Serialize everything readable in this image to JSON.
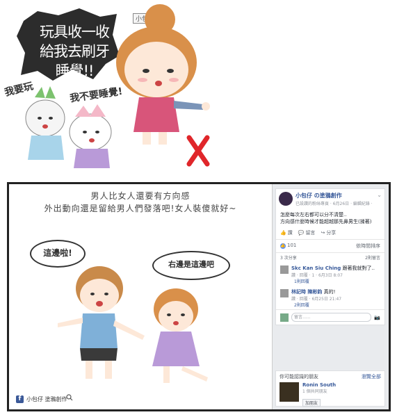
{
  "top_comic": {
    "shout_text": "玩具收一收給我去刷牙睡覺!!",
    "kid1_text": "我要玩",
    "kid2_text": "我不要睡覺!",
    "tag": "小包仔"
  },
  "comic": {
    "caption_line1": "男人比女人還要有方向感",
    "caption_line2": "外出動向還是留給男人們發落吧!女人裝傻就好~",
    "bubble_left": "這邊啦!",
    "bubble_right": "右邊是這邊吧",
    "brand": "小包仔 塗鴉創作"
  },
  "facebook": {
    "page_name": "小包仔 の塗鴉創作",
    "post_meta": "已設讚的粉絲專頁 · 6月26日 · 編輯紀錄 ·",
    "post_text": [
      "怎麼每次左右都可以分不清楚..",
      "方向感什麼時候才能超越那先鼻男生(揉著)"
    ],
    "actions": [
      "讚",
      "留言",
      "分享"
    ],
    "like_count": "101",
    "order_label": "依時間排序",
    "share_label": "3 次分享",
    "shares_right": "2則留言",
    "comments": [
      {
        "name": "Skc Kan Siu Ching",
        "text": "跟著我就對了..",
        "meta": "讚 · 回覆 · 1 · 6月3日 8:07",
        "replies": "1則回覆"
      },
      {
        "name": "林記時 陳彬鈞",
        "text": "真的!",
        "meta": "讚 · 回覆 · 6月25日 21:47",
        "replies": "2則回覆"
      }
    ],
    "write_placeholder": "留言......",
    "people_title": "你可能認識的朋友",
    "see_all": "瀏覽全部",
    "person_name": "Ronin South",
    "person_mutual": "1 個共同朋友",
    "add_friend": "加朋友"
  }
}
